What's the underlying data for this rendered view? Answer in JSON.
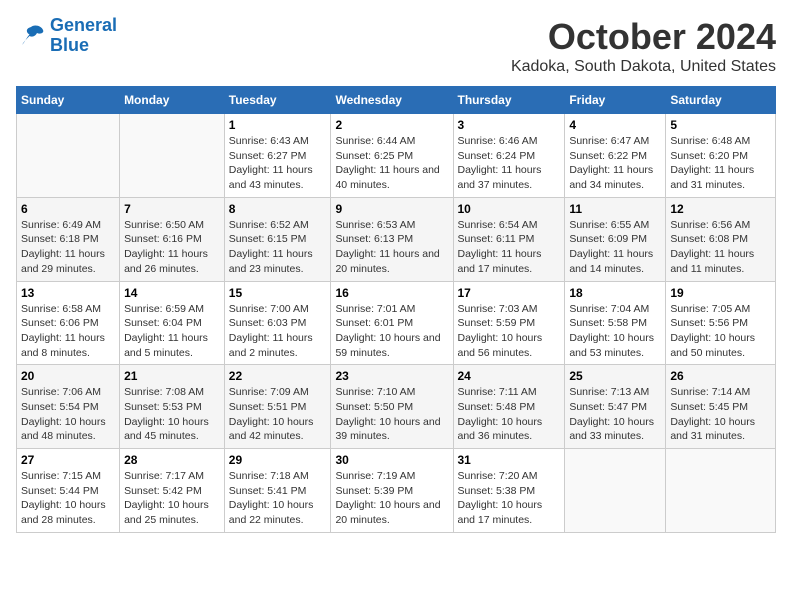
{
  "logo": {
    "line1": "General",
    "line2": "Blue"
  },
  "title": "October 2024",
  "location": "Kadoka, South Dakota, United States",
  "days_of_week": [
    "Sunday",
    "Monday",
    "Tuesday",
    "Wednesday",
    "Thursday",
    "Friday",
    "Saturday"
  ],
  "weeks": [
    [
      {
        "day": "",
        "info": ""
      },
      {
        "day": "",
        "info": ""
      },
      {
        "day": "1",
        "info": "Sunrise: 6:43 AM\nSunset: 6:27 PM\nDaylight: 11 hours and 43 minutes."
      },
      {
        "day": "2",
        "info": "Sunrise: 6:44 AM\nSunset: 6:25 PM\nDaylight: 11 hours and 40 minutes."
      },
      {
        "day": "3",
        "info": "Sunrise: 6:46 AM\nSunset: 6:24 PM\nDaylight: 11 hours and 37 minutes."
      },
      {
        "day": "4",
        "info": "Sunrise: 6:47 AM\nSunset: 6:22 PM\nDaylight: 11 hours and 34 minutes."
      },
      {
        "day": "5",
        "info": "Sunrise: 6:48 AM\nSunset: 6:20 PM\nDaylight: 11 hours and 31 minutes."
      }
    ],
    [
      {
        "day": "6",
        "info": "Sunrise: 6:49 AM\nSunset: 6:18 PM\nDaylight: 11 hours and 29 minutes."
      },
      {
        "day": "7",
        "info": "Sunrise: 6:50 AM\nSunset: 6:16 PM\nDaylight: 11 hours and 26 minutes."
      },
      {
        "day": "8",
        "info": "Sunrise: 6:52 AM\nSunset: 6:15 PM\nDaylight: 11 hours and 23 minutes."
      },
      {
        "day": "9",
        "info": "Sunrise: 6:53 AM\nSunset: 6:13 PM\nDaylight: 11 hours and 20 minutes."
      },
      {
        "day": "10",
        "info": "Sunrise: 6:54 AM\nSunset: 6:11 PM\nDaylight: 11 hours and 17 minutes."
      },
      {
        "day": "11",
        "info": "Sunrise: 6:55 AM\nSunset: 6:09 PM\nDaylight: 11 hours and 14 minutes."
      },
      {
        "day": "12",
        "info": "Sunrise: 6:56 AM\nSunset: 6:08 PM\nDaylight: 11 hours and 11 minutes."
      }
    ],
    [
      {
        "day": "13",
        "info": "Sunrise: 6:58 AM\nSunset: 6:06 PM\nDaylight: 11 hours and 8 minutes."
      },
      {
        "day": "14",
        "info": "Sunrise: 6:59 AM\nSunset: 6:04 PM\nDaylight: 11 hours and 5 minutes."
      },
      {
        "day": "15",
        "info": "Sunrise: 7:00 AM\nSunset: 6:03 PM\nDaylight: 11 hours and 2 minutes."
      },
      {
        "day": "16",
        "info": "Sunrise: 7:01 AM\nSunset: 6:01 PM\nDaylight: 10 hours and 59 minutes."
      },
      {
        "day": "17",
        "info": "Sunrise: 7:03 AM\nSunset: 5:59 PM\nDaylight: 10 hours and 56 minutes."
      },
      {
        "day": "18",
        "info": "Sunrise: 7:04 AM\nSunset: 5:58 PM\nDaylight: 10 hours and 53 minutes."
      },
      {
        "day": "19",
        "info": "Sunrise: 7:05 AM\nSunset: 5:56 PM\nDaylight: 10 hours and 50 minutes."
      }
    ],
    [
      {
        "day": "20",
        "info": "Sunrise: 7:06 AM\nSunset: 5:54 PM\nDaylight: 10 hours and 48 minutes."
      },
      {
        "day": "21",
        "info": "Sunrise: 7:08 AM\nSunset: 5:53 PM\nDaylight: 10 hours and 45 minutes."
      },
      {
        "day": "22",
        "info": "Sunrise: 7:09 AM\nSunset: 5:51 PM\nDaylight: 10 hours and 42 minutes."
      },
      {
        "day": "23",
        "info": "Sunrise: 7:10 AM\nSunset: 5:50 PM\nDaylight: 10 hours and 39 minutes."
      },
      {
        "day": "24",
        "info": "Sunrise: 7:11 AM\nSunset: 5:48 PM\nDaylight: 10 hours and 36 minutes."
      },
      {
        "day": "25",
        "info": "Sunrise: 7:13 AM\nSunset: 5:47 PM\nDaylight: 10 hours and 33 minutes."
      },
      {
        "day": "26",
        "info": "Sunrise: 7:14 AM\nSunset: 5:45 PM\nDaylight: 10 hours and 31 minutes."
      }
    ],
    [
      {
        "day": "27",
        "info": "Sunrise: 7:15 AM\nSunset: 5:44 PM\nDaylight: 10 hours and 28 minutes."
      },
      {
        "day": "28",
        "info": "Sunrise: 7:17 AM\nSunset: 5:42 PM\nDaylight: 10 hours and 25 minutes."
      },
      {
        "day": "29",
        "info": "Sunrise: 7:18 AM\nSunset: 5:41 PM\nDaylight: 10 hours and 22 minutes."
      },
      {
        "day": "30",
        "info": "Sunrise: 7:19 AM\nSunset: 5:39 PM\nDaylight: 10 hours and 20 minutes."
      },
      {
        "day": "31",
        "info": "Sunrise: 7:20 AM\nSunset: 5:38 PM\nDaylight: 10 hours and 17 minutes."
      },
      {
        "day": "",
        "info": ""
      },
      {
        "day": "",
        "info": ""
      }
    ]
  ]
}
